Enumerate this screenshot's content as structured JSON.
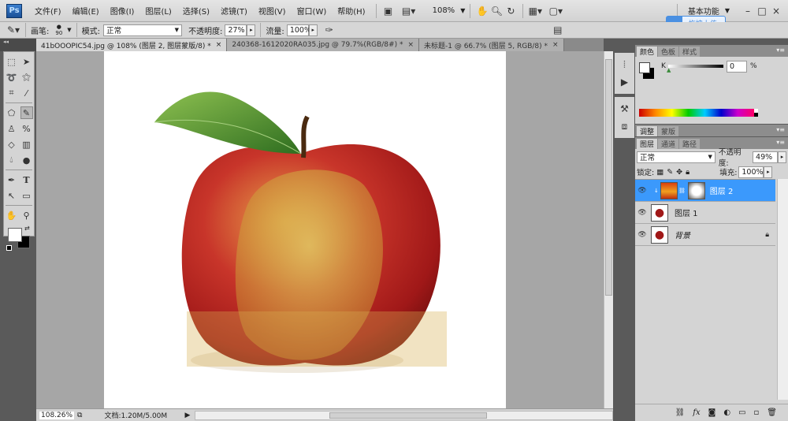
{
  "app": {
    "logo": "Ps"
  },
  "menu": [
    "文件(F)",
    "编辑(E)",
    "图像(I)",
    "图层(L)",
    "选择(S)",
    "滤镜(T)",
    "视图(V)",
    "窗口(W)",
    "帮助(H)"
  ],
  "appbar": {
    "zoom": "108%",
    "workspace": "基本功能"
  },
  "baidu_upload": "拖拽上传",
  "options": {
    "brush_label": "画笔:",
    "brush_size": "90",
    "mode_label": "模式:",
    "mode": "正常",
    "opacity_label": "不透明度:",
    "opacity": "27%",
    "flow_label": "流量:",
    "flow": "100%"
  },
  "tabs": [
    {
      "label": "41bOOOPIC54.jpg @ 108% (图层 2, 图层蒙版/8) *",
      "active": true
    },
    {
      "label": "240368-1612020RA035.jpg @ 79.7%(RGB/8#) *",
      "active": false
    },
    {
      "label": "未标题-1 @ 66.7% (图层 5, RGB/8) *",
      "active": false
    }
  ],
  "status": {
    "zoom": "108.26%",
    "doc": "文档:1.20M/5.00M"
  },
  "color_panel": {
    "tabs": [
      "颜色",
      "色板",
      "样式"
    ],
    "channel": "K",
    "value": "0",
    "unit": "%"
  },
  "adjust_panel": {
    "tabs": [
      "调整",
      "蒙版"
    ]
  },
  "layers_panel": {
    "tabs": [
      "图层",
      "通道",
      "路径"
    ],
    "blend_mode": "正常",
    "opacity_label": "不透明度:",
    "opacity": "49%",
    "lock_label": "锁定:",
    "fill_label": "填充:",
    "fill": "100%",
    "layers": [
      {
        "name": "图层 2",
        "selected": true
      },
      {
        "name": "图层 1",
        "selected": false
      },
      {
        "name": "背景",
        "selected": false,
        "locked": true
      }
    ]
  },
  "colors": {
    "selected_layer": "#3b99fc",
    "foreground": "#ffffff",
    "background": "#000000"
  }
}
